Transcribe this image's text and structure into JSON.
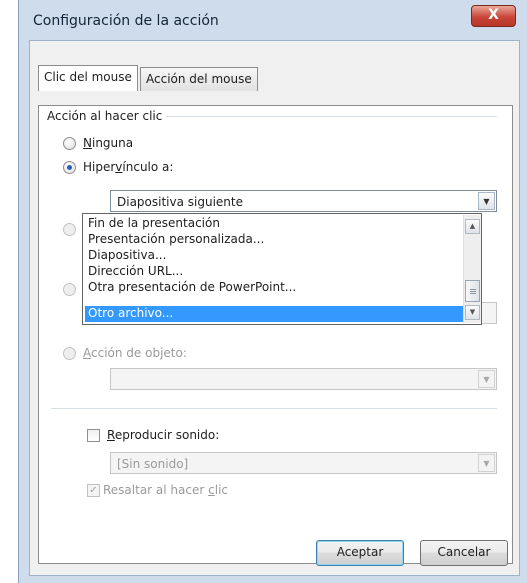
{
  "window": {
    "title": "Configuración de la acción",
    "close_glyph": "X"
  },
  "tabs": [
    {
      "label": "Clic del mouse",
      "active": true
    },
    {
      "label": "Acción del mouse",
      "active": false
    }
  ],
  "group": {
    "label": "Acción al hacer clic"
  },
  "options": {
    "none": {
      "pre": "",
      "key": "N",
      "post": "inguna",
      "selected": false
    },
    "hyperlink": {
      "pre": "Hiper",
      "key": "v",
      "post": "ínculo a:",
      "selected": true
    },
    "object_action": {
      "pre": "",
      "key": "A",
      "post": "cción de objeto:",
      "enabled": false
    }
  },
  "hyperlink_combo": {
    "value": "Diapositiva siguiente",
    "arrow_icon": "chevron-down-icon"
  },
  "dropdown": {
    "items": [
      "Fin de la presentación",
      "Presentación personalizada...",
      "Diapositiva...",
      "Dirección URL...",
      "Otra presentación de PowerPoint...",
      "Otro archivo..."
    ],
    "selected_index": 5,
    "scroll_up_icon": "▲",
    "scroll_down_icon": "▼"
  },
  "object_action_combo": {
    "value": ""
  },
  "sound": {
    "checkbox": {
      "pre": "",
      "key": "R",
      "post": "eproducir sonido:",
      "checked": false
    },
    "combo_value": "[Sin sonido]"
  },
  "highlight": {
    "pre": "Resaltar al hacer ",
    "key": "c",
    "post": "lic",
    "checked": true,
    "enabled": false
  },
  "buttons": {
    "ok": "Aceptar",
    "cancel": "Cancelar"
  },
  "colors": {
    "selection": "#3399ff",
    "title_bar": "#cfdceb",
    "close_button": "#c8473a"
  }
}
